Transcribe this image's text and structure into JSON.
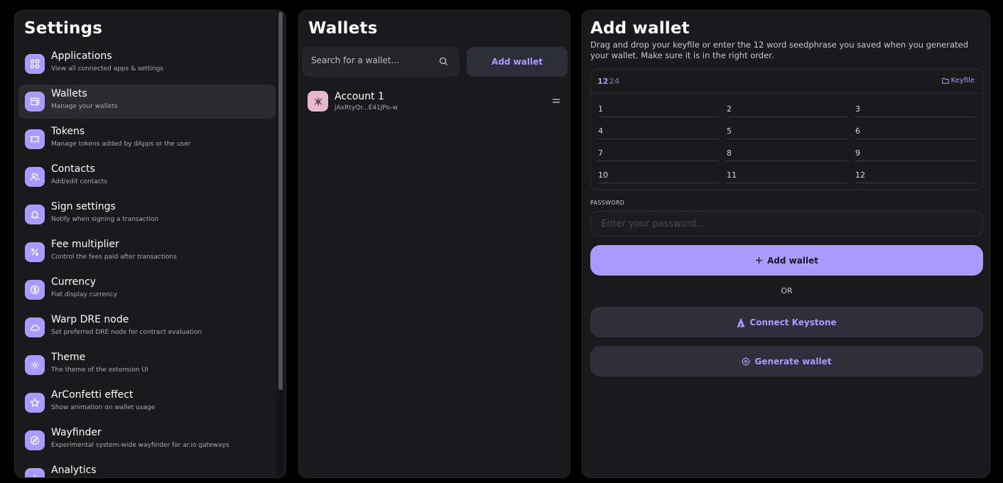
{
  "settings": {
    "title": "Settings",
    "items": [
      {
        "label": "Applications",
        "description": "View all connected apps & settings",
        "icon": "grid-icon"
      },
      {
        "label": "Wallets",
        "description": "Manage your wallets",
        "icon": "wallet-icon"
      },
      {
        "label": "Tokens",
        "description": "Manage tokens added by dApps or the user",
        "icon": "ticket-icon"
      },
      {
        "label": "Contacts",
        "description": "Add/edit contacts",
        "icon": "users-icon"
      },
      {
        "label": "Sign settings",
        "description": "Notify when signing a transaction",
        "icon": "bell-icon"
      },
      {
        "label": "Fee multiplier",
        "description": "Control the fees paid after transactions",
        "icon": "percent-icon"
      },
      {
        "label": "Currency",
        "description": "Fiat display currency",
        "icon": "dollar-circle-icon"
      },
      {
        "label": "Warp DRE node",
        "description": "Set preferred DRE node for contract evaluation",
        "icon": "cloud-icon"
      },
      {
        "label": "Theme",
        "description": "The theme of the extension UI",
        "icon": "sun-icon"
      },
      {
        "label": "ArConfetti effect",
        "description": "Show animation on wallet usage",
        "icon": "star-icon"
      },
      {
        "label": "Wayfinder",
        "description": "Experimental system-wide wayfinder for ar.io gateways",
        "icon": "compass-icon"
      },
      {
        "label": "Analytics",
        "description": "",
        "icon": "chart-icon"
      }
    ],
    "active_item": "Wallets"
  },
  "wallets": {
    "title": "Wallets",
    "search_placeholder": "Search for a wallet...",
    "add_button": "Add wallet",
    "accounts": [
      {
        "name": "Account 1",
        "address": "jAxRtyQr...E41JPo-w"
      }
    ]
  },
  "add_wallet": {
    "title": "Add wallet",
    "description": "Drag and drop your keyfile or enter the 12 word seedphrase you saved when you generated your wallet. Make sure it is in the right order.",
    "length_options": [
      "12",
      "24"
    ],
    "selected_length": "12",
    "keyfile_label": "Keyfile",
    "seed_numbers": [
      "1",
      "2",
      "3",
      "4",
      "5",
      "6",
      "7",
      "8",
      "9",
      "10",
      "11",
      "12"
    ],
    "password_label": "PASSWORD",
    "password_placeholder": "Enter your password...",
    "add_button": "Add wallet",
    "or_text": "OR",
    "keystone_button": "Connect Keystone",
    "generate_button": "Generate wallet"
  },
  "colors": {
    "accent": "#ab9aff",
    "background": "#000000",
    "panel": "#1a1a1c"
  }
}
